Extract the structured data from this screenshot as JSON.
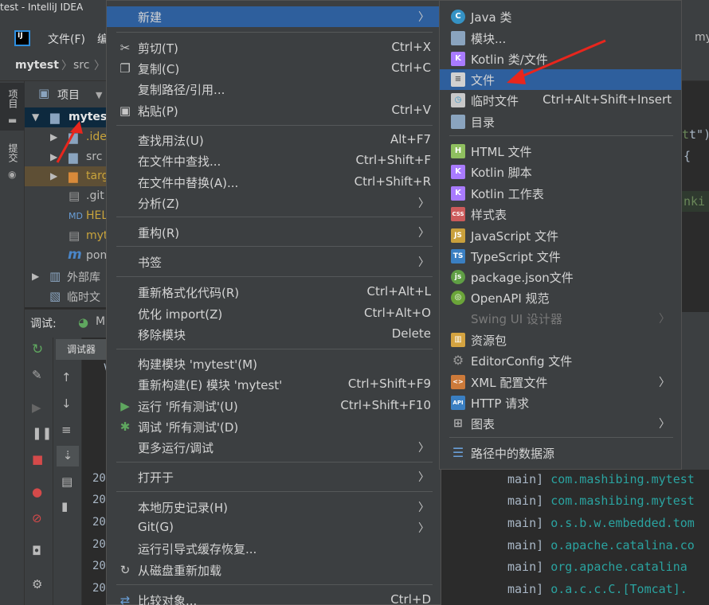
{
  "window": {
    "title": "test - IntelliJ IDEA"
  },
  "menubar": {
    "file": "文件(F)",
    "edit_partial": "编",
    "right_partial": "my"
  },
  "navbar": {
    "project": "mytest",
    "folder": "src"
  },
  "side_tabs": {
    "project": "项目",
    "commit": "提交"
  },
  "project_panel": {
    "title": "项目",
    "tree": [
      {
        "label": "mytest",
        "type": "module",
        "selected": true
      },
      {
        "label": ".ide",
        "type": "folder"
      },
      {
        "label": "src",
        "type": "folder"
      },
      {
        "label": "targ",
        "type": "excluded"
      },
      {
        "label": ".git",
        "type": "file"
      },
      {
        "label": "HEL",
        "type": "markdown"
      },
      {
        "label": "myt",
        "type": "file"
      },
      {
        "label": "pom",
        "type": "maven"
      },
      {
        "label": "外部库",
        "type": "library"
      },
      {
        "label": "临时文",
        "type": "scratch"
      }
    ]
  },
  "debug": {
    "label": "调试:",
    "run_partial": "M",
    "tab": "调试器",
    "console_nums": [
      "20",
      "20",
      "20",
      "20",
      "20",
      "20"
    ],
    "console_frag": "V"
  },
  "code_frag": {
    "line1": "t\")",
    "line2": "{",
    "line3": "nki"
  },
  "log": {
    "lines": [
      {
        "thread": "main]",
        "source": "com.mashibing.mytest"
      },
      {
        "thread": "main]",
        "source": "com.mashibing.mytest"
      },
      {
        "thread": "main]",
        "source": "o.s.b.w.embedded.tom"
      },
      {
        "thread": "main]",
        "source": "o.apache.catalina.co"
      },
      {
        "thread": "main]",
        "source": "org.apache.catalina"
      },
      {
        "thread": "main]",
        "source": "o.a.c.c.C.[Tomcat]."
      }
    ]
  },
  "context_menu": {
    "items": [
      {
        "label": "新建",
        "shortcut": "",
        "submenu": true,
        "highlighted": true
      },
      {
        "label": "剪切(T)",
        "shortcut": "Ctrl+X",
        "icon": "scissors-icon"
      },
      {
        "label": "复制(C)",
        "shortcut": "Ctrl+C",
        "icon": "copy-icon"
      },
      {
        "label": "复制路径/引用...",
        "shortcut": ""
      },
      {
        "label": "粘贴(P)",
        "shortcut": "Ctrl+V",
        "icon": "paste-icon"
      },
      {
        "label": "查找用法(U)",
        "shortcut": "Alt+F7"
      },
      {
        "label": "在文件中查找...",
        "shortcut": "Ctrl+Shift+F"
      },
      {
        "label": "在文件中替换(A)...",
        "shortcut": "Ctrl+Shift+R"
      },
      {
        "label": "分析(Z)",
        "shortcut": "",
        "submenu": true
      },
      {
        "label": "重构(R)",
        "shortcut": "",
        "submenu": true
      },
      {
        "label": "书签",
        "shortcut": "",
        "submenu": true
      },
      {
        "label": "重新格式化代码(R)",
        "shortcut": "Ctrl+Alt+L"
      },
      {
        "label": "优化 import(Z)",
        "shortcut": "Ctrl+Alt+O"
      },
      {
        "label": "移除模块",
        "shortcut": "Delete"
      },
      {
        "label": "构建模块 'mytest'(M)",
        "shortcut": ""
      },
      {
        "label": "重新构建(E) 模块 'mytest'",
        "shortcut": "Ctrl+Shift+F9"
      },
      {
        "label": "运行 '所有测试'(U)",
        "shortcut": "Ctrl+Shift+F10",
        "icon": "run-icon"
      },
      {
        "label": "调试 '所有测试'(D)",
        "shortcut": "",
        "icon": "debug-icon"
      },
      {
        "label": "更多运行/调试",
        "shortcut": "",
        "submenu": true
      },
      {
        "label": "打开于",
        "shortcut": "",
        "submenu": true
      },
      {
        "label": "本地历史记录(H)",
        "shortcut": "",
        "submenu": true
      },
      {
        "label": "Git(G)",
        "shortcut": "",
        "submenu": true
      },
      {
        "label": "运行引导式缓存恢复...",
        "shortcut": ""
      },
      {
        "label": "从磁盘重新加载",
        "shortcut": "",
        "icon": "reload-icon"
      },
      {
        "label": "比较对象...",
        "shortcut": "Ctrl+D",
        "icon": "compare-icon"
      }
    ]
  },
  "new_submenu": {
    "items": [
      {
        "label": "Java 类",
        "icon": "java-class-icon",
        "badge": "C",
        "color": "#3592c4"
      },
      {
        "label": "模块...",
        "icon": "module-icon",
        "badge": "",
        "color": "#8aa4bf"
      },
      {
        "label": "Kotlin 类/文件",
        "icon": "kotlin-icon",
        "badge": "K",
        "color": "#a97bff"
      },
      {
        "label": "文件",
        "icon": "file-icon",
        "badge": "",
        "color": "#d0d0d0",
        "highlighted": true
      },
      {
        "label": "临时文件",
        "shortcut": "Ctrl+Alt+Shift+Insert",
        "icon": "scratch-icon",
        "badge": "",
        "color": "#c8c8c8"
      },
      {
        "label": "目录",
        "icon": "folder-icon",
        "badge": "",
        "color": "#8aa4bf"
      },
      {
        "label": "HTML 文件",
        "icon": "html-icon",
        "badge": "H",
        "color": "#8fbf5f"
      },
      {
        "label": "Kotlin 脚本",
        "icon": "kotlin-script-icon",
        "badge": "K",
        "color": "#a97bff"
      },
      {
        "label": "Kotlin 工作表",
        "icon": "kotlin-worksheet-icon",
        "badge": "K",
        "color": "#a97bff"
      },
      {
        "label": "样式表",
        "icon": "css-icon",
        "badge": "CSS",
        "color": "#cc5b5b"
      },
      {
        "label": "JavaScript 文件",
        "icon": "javascript-icon",
        "badge": "JS",
        "color": "#c9a03c"
      },
      {
        "label": "TypeScript 文件",
        "icon": "typescript-icon",
        "badge": "TS",
        "color": "#3a7fc2"
      },
      {
        "label": "package.json文件",
        "icon": "nodejs-icon",
        "badge": "js",
        "color": "#5f9e44"
      },
      {
        "label": "OpenAPI 规范",
        "icon": "openapi-icon",
        "badge": "",
        "color": "#6ba539"
      },
      {
        "label": "Swing UI 设计器",
        "icon": "",
        "badge": "",
        "color": "",
        "disabled": true,
        "submenu": true
      },
      {
        "label": "资源包",
        "icon": "resource-bundle-icon",
        "badge": "",
        "color": "#d4a340"
      },
      {
        "label": "EditorConfig 文件",
        "icon": "gear-icon",
        "badge": "⚙",
        "color": "#9a9a9a"
      },
      {
        "label": "XML 配置文件",
        "icon": "xml-icon",
        "badge": "<>",
        "color": "#cc7a3a",
        "submenu": true
      },
      {
        "label": "HTTP 请求",
        "icon": "api-icon",
        "badge": "API",
        "color": "#3a7fc2"
      },
      {
        "label": "图表",
        "icon": "diagram-icon",
        "badge": "",
        "color": "#b0b0b0",
        "submenu": true
      },
      {
        "label": "路径中的数据源",
        "icon": "database-icon",
        "badge": "",
        "color": "#6a9fd8"
      }
    ]
  }
}
